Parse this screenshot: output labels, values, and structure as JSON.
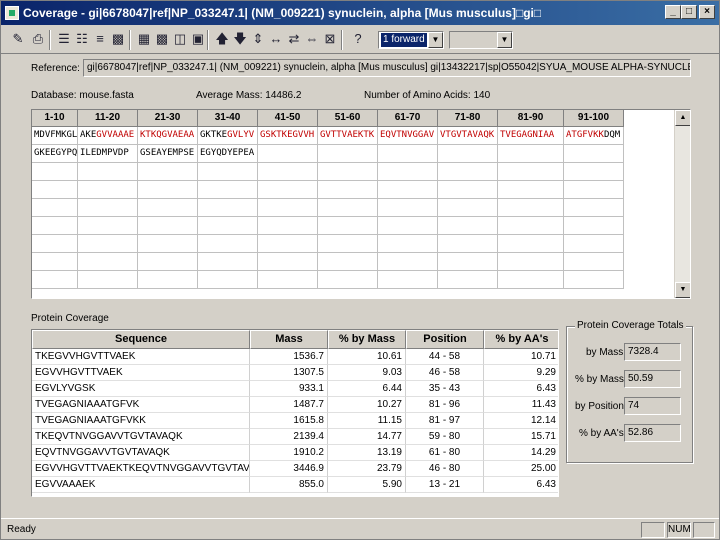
{
  "window": {
    "title": "Coverage - gi|6678047|ref|NP_033247.1| (NM_009221) synuclein, alpha [Mus musculus]□gi□",
    "min_label": "_",
    "max_label": "□",
    "close_label": "×"
  },
  "toolbar": {
    "direction_value": "1 forward",
    "second_value": ""
  },
  "info": {
    "reference_label": "Reference:",
    "reference_value": "gi|6678047|ref|NP_033247.1| (NM_009221) synuclein, alpha [Mus musculus] gi|13432217|sp|O55042|SYUA_MOUSE ALPHA-SYNUCLEIN (NON-A BETA",
    "database_label": "Database: mouse.fasta",
    "avg_mass_label": "Average Mass: 14486.2",
    "num_aa_label": "Number of Amino Acids: 140"
  },
  "sequence_grid": {
    "headers": [
      "1-10",
      "11-20",
      "21-30",
      "31-40",
      "41-50",
      "51-60",
      "61-70",
      "71-80",
      "81-90",
      "91-100"
    ],
    "rows": [
      [
        [
          {
            "t": "MDVFMKGLSK",
            "c": "blk"
          }
        ],
        [
          {
            "t": "AKE",
            "c": "blk"
          },
          {
            "t": "GVVAAAE",
            "c": "red"
          }
        ],
        [
          {
            "t": "KTKQGVAEAA",
            "c": "red"
          }
        ],
        [
          {
            "t": "GKTKE",
            "c": "blk"
          },
          {
            "t": "GVLYV",
            "c": "red"
          }
        ],
        [
          {
            "t": "GSKTKEGVVH",
            "c": "red"
          }
        ],
        [
          {
            "t": "GVTTVAEKTK",
            "c": "red"
          }
        ],
        [
          {
            "t": "EQVTNVGGAV",
            "c": "red"
          }
        ],
        [
          {
            "t": "VTGVTAVAQK",
            "c": "red"
          }
        ],
        [
          {
            "t": "TVEGAGNIAA",
            "c": "red"
          }
        ],
        [
          {
            "t": "ATGFVKK",
            "c": "red"
          },
          {
            "t": "DQM",
            "c": "blk"
          }
        ]
      ],
      [
        [
          {
            "t": "GKEEGYPQEG",
            "c": "blk"
          }
        ],
        [
          {
            "t": "ILEDMPVDP",
            "c": "blk"
          }
        ],
        [
          {
            "t": "GSEAYEMPSE",
            "c": "blk"
          }
        ],
        [
          {
            "t": "EGYQDYEPEA",
            "c": "blk"
          }
        ]
      ]
    ]
  },
  "protein_coverage": {
    "label": "Protein Coverage",
    "headers": [
      "Sequence",
      "Mass",
      "% by Mass",
      "Position",
      "% by AA's"
    ],
    "rows": [
      [
        "TKEGVVHGVTTVAEK",
        "1536.7",
        "10.61",
        "44 - 58",
        "10.71"
      ],
      [
        "EGVVHGVTTVAEK",
        "1307.5",
        "9.03",
        "46 - 58",
        "9.29"
      ],
      [
        "EGVLYVGSK",
        "933.1",
        "6.44",
        "35 - 43",
        "6.43"
      ],
      [
        "TVEGAGNIAAATGFVK",
        "1487.7",
        "10.27",
        "81 - 96",
        "11.43"
      ],
      [
        "TVEGAGNIAAATGFVKK",
        "1615.8",
        "11.15",
        "81 - 97",
        "12.14"
      ],
      [
        "TKEQVTNVGGAVVTGVTAVAQK",
        "2139.4",
        "14.77",
        "59 - 80",
        "15.71"
      ],
      [
        "EQVTNVGGAVVTGVTAVAQK",
        "1910.2",
        "13.19",
        "61 - 80",
        "14.29"
      ],
      [
        "EGVVHGVTTVAEKTKEQVTNVGGAVVTGVTAVAQK",
        "3446.9",
        "23.79",
        "46 - 80",
        "25.00"
      ],
      [
        "EGVVAAAEK",
        "855.0",
        "5.90",
        "13 - 21",
        "6.43"
      ]
    ]
  },
  "totals": {
    "title": "Protein Coverage Totals",
    "by_mass_label": "by Mass:",
    "by_mass_value": "7328.4",
    "pct_mass_label": "% by Mass:",
    "pct_mass_value": "50.59",
    "by_position_label": "by Position:",
    "by_position_value": "74",
    "pct_aa_label": "% by AA's:",
    "pct_aa_value": "52.86"
  },
  "status": {
    "text": "Ready",
    "num": "NUM"
  }
}
